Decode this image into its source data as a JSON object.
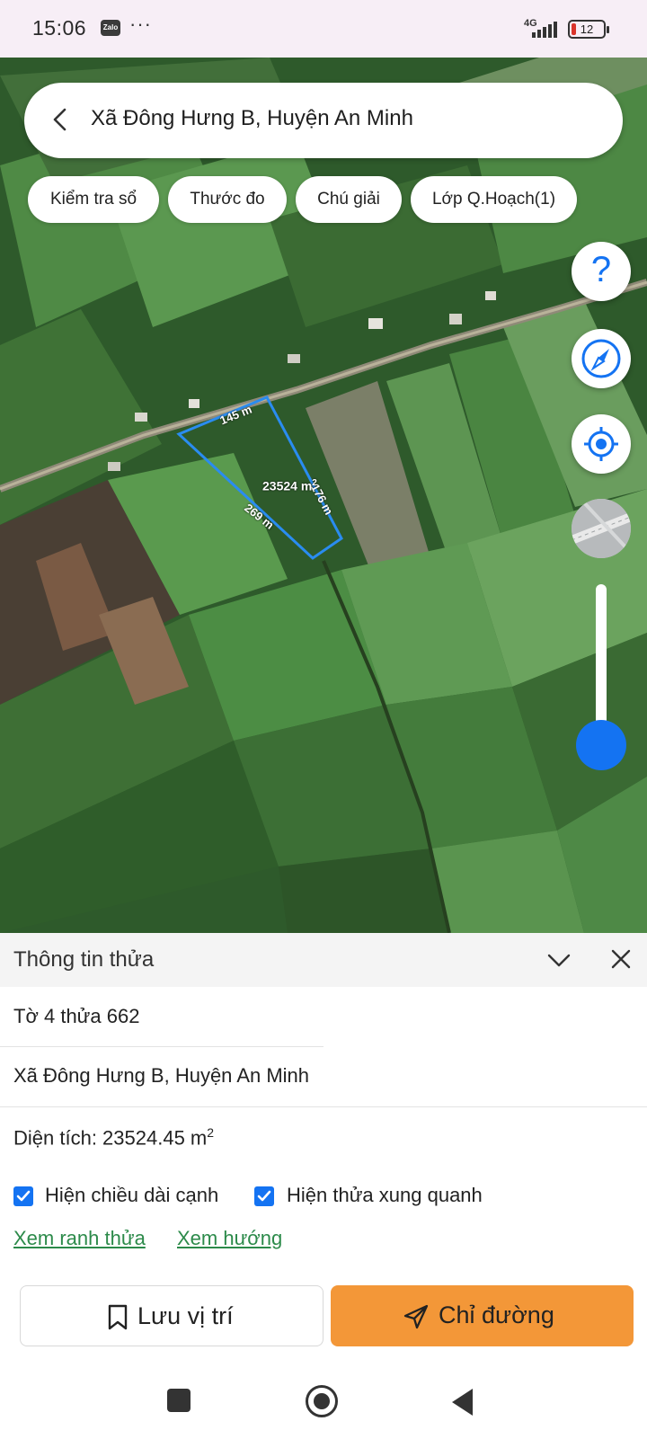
{
  "status_bar": {
    "time": "15:06",
    "app_badge": "Zalo",
    "more": "···",
    "network": "4G",
    "battery": "12"
  },
  "search": {
    "title": "Xã Đông Hưng B, Huyện An Minh"
  },
  "chips": [
    {
      "label": "Kiểm tra sổ"
    },
    {
      "label": "Thước đo"
    },
    {
      "label": "Chú giải"
    },
    {
      "label": "Lớp Q.Hoạch(1)"
    }
  ],
  "map": {
    "parcel": {
      "top_edge": "145 m",
      "right_edge": "176 m",
      "left_edge": "269 m",
      "area_value": "23524 m",
      "area_unit_power": "2"
    },
    "zoom_level_fraction": 0.15,
    "help_label": "?",
    "accent": "#1473f2"
  },
  "panel": {
    "title": "Thông tin thửa",
    "sheet_parcel": "Tờ 4 thửa 662",
    "address": "Xã Đông Hưng B, Huyện An Minh",
    "area_label": "Diện tích: 23524.45 m",
    "area_power": "2",
    "checkbox_edges": "Hiện chiều dài cạnh",
    "checkbox_neighbors": "Hiện thửa xung quanh",
    "link_boundary": "Xem ranh thửa",
    "link_direction": "Xem hướng"
  },
  "actions": {
    "save": "Lưu vị trí",
    "route": "Chỉ đường",
    "route_color": "#f39738"
  }
}
